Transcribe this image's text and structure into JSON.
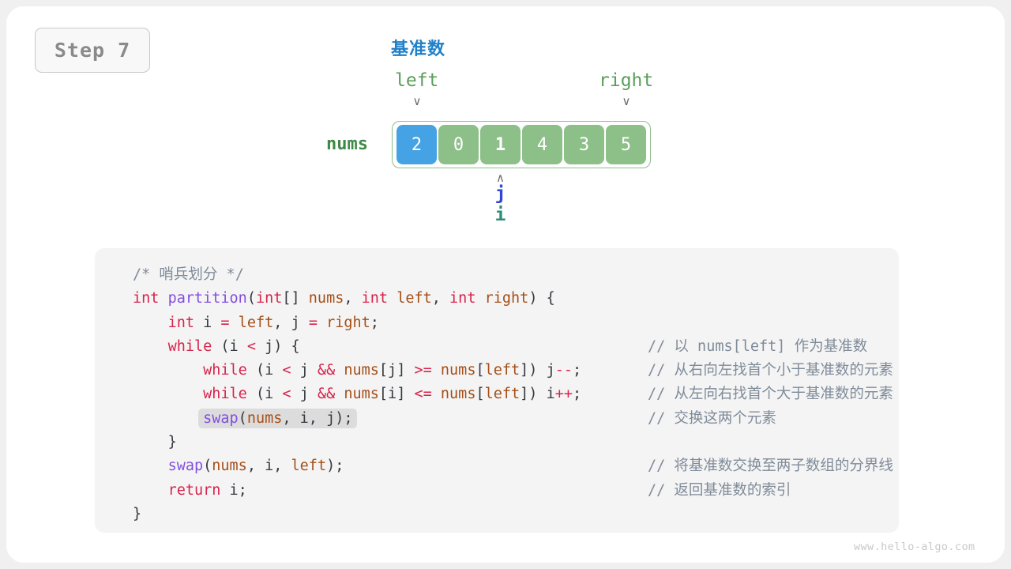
{
  "step_badge": {
    "label": "Step 7"
  },
  "diagram": {
    "pivot_label": "基准数",
    "array_name": "nums",
    "left_label": "left",
    "right_label": "right",
    "down_arrow_glyph": "∨",
    "up_arrow_glyph": "∧",
    "cells": [
      {
        "value": "2",
        "state": "pivot"
      },
      {
        "value": "0",
        "state": "normal"
      },
      {
        "value": "1",
        "state": "marked"
      },
      {
        "value": "4",
        "state": "normal"
      },
      {
        "value": "3",
        "state": "normal"
      },
      {
        "value": "5",
        "state": "normal"
      }
    ],
    "left_index": 0,
    "right_index": 5,
    "markers": {
      "j_label": "j",
      "i_label": "i",
      "j_index": 2,
      "i_index": 2
    },
    "colors": {
      "pivot_blue": "#45a3e5",
      "cell_green": "#8dbf89",
      "frame_green": "#8dbf89",
      "nums_label_green": "#3e8a47",
      "pointer_green": "#5a9e5a",
      "pivot_text_blue": "#2080c8",
      "j_blue": "#2f46d8",
      "i_teal": "#2e8c7a"
    }
  },
  "code": {
    "language": "java",
    "lines": [
      {
        "indent": 0,
        "tokens": [
          {
            "t": "/* 哨兵划分 */",
            "c": "cmt"
          }
        ],
        "comment": ""
      },
      {
        "indent": 0,
        "tokens": [
          {
            "t": "int",
            "c": "kw"
          },
          {
            "t": " ",
            "c": "pln"
          },
          {
            "t": "partition",
            "c": "fn"
          },
          {
            "t": "(",
            "c": "pln"
          },
          {
            "t": "int",
            "c": "kw"
          },
          {
            "t": "[] ",
            "c": "pln"
          },
          {
            "t": "nums",
            "c": "var"
          },
          {
            "t": ", ",
            "c": "pln"
          },
          {
            "t": "int",
            "c": "kw"
          },
          {
            "t": " ",
            "c": "pln"
          },
          {
            "t": "left",
            "c": "var"
          },
          {
            "t": ", ",
            "c": "pln"
          },
          {
            "t": "int",
            "c": "kw"
          },
          {
            "t": " ",
            "c": "pln"
          },
          {
            "t": "right",
            "c": "var"
          },
          {
            "t": ") {",
            "c": "pln"
          }
        ],
        "comment": ""
      },
      {
        "indent": 1,
        "tokens": [
          {
            "t": "int",
            "c": "kw"
          },
          {
            "t": " i ",
            "c": "pln"
          },
          {
            "t": "=",
            "c": "op"
          },
          {
            "t": " ",
            "c": "pln"
          },
          {
            "t": "left",
            "c": "var"
          },
          {
            "t": ", j ",
            "c": "pln"
          },
          {
            "t": "=",
            "c": "op"
          },
          {
            "t": " ",
            "c": "pln"
          },
          {
            "t": "right",
            "c": "var"
          },
          {
            "t": ";",
            "c": "pln"
          }
        ],
        "comment": ""
      },
      {
        "indent": 1,
        "tokens": [
          {
            "t": "while",
            "c": "kw"
          },
          {
            "t": " (i ",
            "c": "pln"
          },
          {
            "t": "<",
            "c": "op"
          },
          {
            "t": " j) {",
            "c": "pln"
          }
        ],
        "comment": "// 以 nums[left] 作为基准数"
      },
      {
        "indent": 2,
        "tokens": [
          {
            "t": "while",
            "c": "kw"
          },
          {
            "t": " (i ",
            "c": "pln"
          },
          {
            "t": "<",
            "c": "op"
          },
          {
            "t": " j ",
            "c": "pln"
          },
          {
            "t": "&&",
            "c": "op"
          },
          {
            "t": " ",
            "c": "pln"
          },
          {
            "t": "nums",
            "c": "var"
          },
          {
            "t": "[j] ",
            "c": "pln"
          },
          {
            "t": ">=",
            "c": "op"
          },
          {
            "t": " ",
            "c": "pln"
          },
          {
            "t": "nums",
            "c": "var"
          },
          {
            "t": "[",
            "c": "pln"
          },
          {
            "t": "left",
            "c": "var"
          },
          {
            "t": "]) j",
            "c": "pln"
          },
          {
            "t": "--",
            "c": "op"
          },
          {
            "t": ";",
            "c": "pln"
          }
        ],
        "comment": "// 从右向左找首个小于基准数的元素"
      },
      {
        "indent": 2,
        "tokens": [
          {
            "t": "while",
            "c": "kw"
          },
          {
            "t": " (i ",
            "c": "pln"
          },
          {
            "t": "<",
            "c": "op"
          },
          {
            "t": " j ",
            "c": "pln"
          },
          {
            "t": "&&",
            "c": "op"
          },
          {
            "t": " ",
            "c": "pln"
          },
          {
            "t": "nums",
            "c": "var"
          },
          {
            "t": "[i] ",
            "c": "pln"
          },
          {
            "t": "<=",
            "c": "op"
          },
          {
            "t": " ",
            "c": "pln"
          },
          {
            "t": "nums",
            "c": "var"
          },
          {
            "t": "[",
            "c": "pln"
          },
          {
            "t": "left",
            "c": "var"
          },
          {
            "t": "]) i",
            "c": "pln"
          },
          {
            "t": "++",
            "c": "op"
          },
          {
            "t": ";",
            "c": "pln"
          }
        ],
        "comment": "// 从左向右找首个大于基准数的元素"
      },
      {
        "indent": 2,
        "highlight": true,
        "tokens": [
          {
            "t": "swap",
            "c": "fn"
          },
          {
            "t": "(",
            "c": "pln"
          },
          {
            "t": "nums",
            "c": "var"
          },
          {
            "t": ", i, j);",
            "c": "pln"
          }
        ],
        "comment": "// 交换这两个元素"
      },
      {
        "indent": 1,
        "tokens": [
          {
            "t": "}",
            "c": "pln"
          }
        ],
        "comment": ""
      },
      {
        "indent": 1,
        "tokens": [
          {
            "t": "swap",
            "c": "fn"
          },
          {
            "t": "(",
            "c": "pln"
          },
          {
            "t": "nums",
            "c": "var"
          },
          {
            "t": ", i, ",
            "c": "pln"
          },
          {
            "t": "left",
            "c": "var"
          },
          {
            "t": ");",
            "c": "pln"
          }
        ],
        "comment": "// 将基准数交换至两子数组的分界线"
      },
      {
        "indent": 1,
        "tokens": [
          {
            "t": "return",
            "c": "kw"
          },
          {
            "t": " i;",
            "c": "pln"
          }
        ],
        "comment": "// 返回基准数的索引"
      },
      {
        "indent": 0,
        "tokens": [
          {
            "t": "}",
            "c": "pln"
          }
        ],
        "comment": ""
      }
    ]
  },
  "footer": {
    "watermark": "www.hello-algo.com"
  }
}
